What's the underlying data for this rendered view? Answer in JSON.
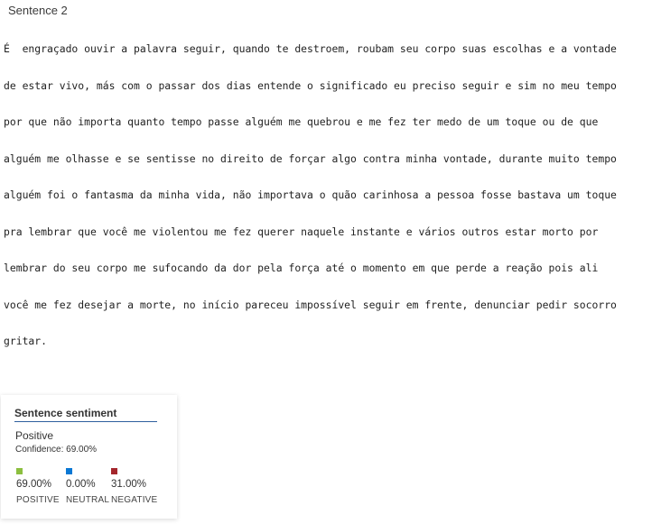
{
  "header": {
    "title": "Sentence 2"
  },
  "sentence": {
    "lines": [
      "É  engraçado ouvir a palavra seguir, quando te destroem, roubam seu corpo suas escolhas e a vontade",
      "de estar vivo, más com o passar dos dias entende o significado eu preciso seguir e sim no meu tempo",
      "por que não importa quanto tempo passe alguém me quebrou e me fez ter medo de um toque ou de que",
      "alguém me olhasse e se sentisse no direito de forçar algo contra minha vontade, durante muito tempo",
      "alguém foi o fantasma da minha vida, não importava o quão carinhosa a pessoa fosse bastava um toque",
      "pra lembrar que você me violentou me fez querer naquele instante e vários outros estar morto por",
      "lembrar do seu corpo me sufocando da dor pela força até o momento em que perde a reação pois ali",
      "você me fez desejar a morte, no início pareceu impossível seguir em frente, denunciar pedir socorro",
      "gritar."
    ]
  },
  "sentiment_card": {
    "title": "Sentence sentiment",
    "label": "Positive",
    "confidence": "Confidence: 69.00%",
    "scores": [
      {
        "name": "POSITIVE",
        "value": "69.00%",
        "color": "#8cbf3f"
      },
      {
        "name": "NEUTRAL",
        "value": "0.00%",
        "color": "#0a78d4"
      },
      {
        "name": "NEGATIVE",
        "value": "31.00%",
        "color": "#a4262c"
      }
    ]
  }
}
